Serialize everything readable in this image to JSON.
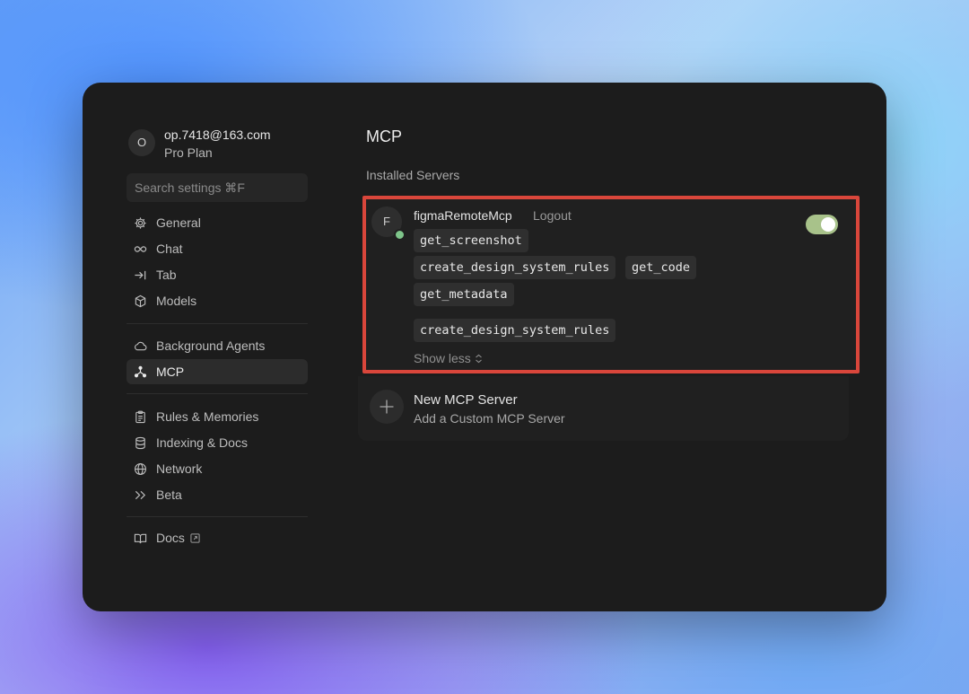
{
  "account": {
    "avatar_initial": "O",
    "email": "op.7418@163.com",
    "plan": "Pro Plan"
  },
  "search": {
    "placeholder": "Search settings ⌘F"
  },
  "sidebar": {
    "groups": [
      [
        {
          "label": "General",
          "icon": "gear-icon"
        },
        {
          "label": "Chat",
          "icon": "infinity-icon"
        },
        {
          "label": "Tab",
          "icon": "arrow-right-bar-icon"
        },
        {
          "label": "Models",
          "icon": "cube-icon"
        }
      ],
      [
        {
          "label": "Background Agents",
          "icon": "cloud-icon"
        },
        {
          "label": "MCP",
          "icon": "mcp-icon",
          "active": true
        }
      ],
      [
        {
          "label": "Rules & Memories",
          "icon": "clipboard-icon"
        },
        {
          "label": "Indexing & Docs",
          "icon": "database-icon"
        },
        {
          "label": "Network",
          "icon": "globe-icon"
        },
        {
          "label": "Beta",
          "icon": "double-chevron-icon"
        }
      ],
      [
        {
          "label": "Docs",
          "icon": "book-icon",
          "external": true
        }
      ]
    ]
  },
  "main": {
    "title": "MCP",
    "section_title": "Installed Servers",
    "server": {
      "avatar_initial": "F",
      "name": "figmaRemoteMcp",
      "logout_label": "Logout",
      "enabled": true,
      "status_color": "#7ec58a",
      "tools": [
        "get_screenshot",
        "create_design_system_rules",
        "get_code",
        "get_metadata",
        "create_design_system_rules"
      ],
      "show_less_label": "Show less"
    },
    "new_server": {
      "title": "New MCP Server",
      "subtitle": "Add a Custom MCP Server"
    }
  },
  "colors": {
    "highlight_border": "#d9463b",
    "toggle_on": "#a8c28a"
  }
}
